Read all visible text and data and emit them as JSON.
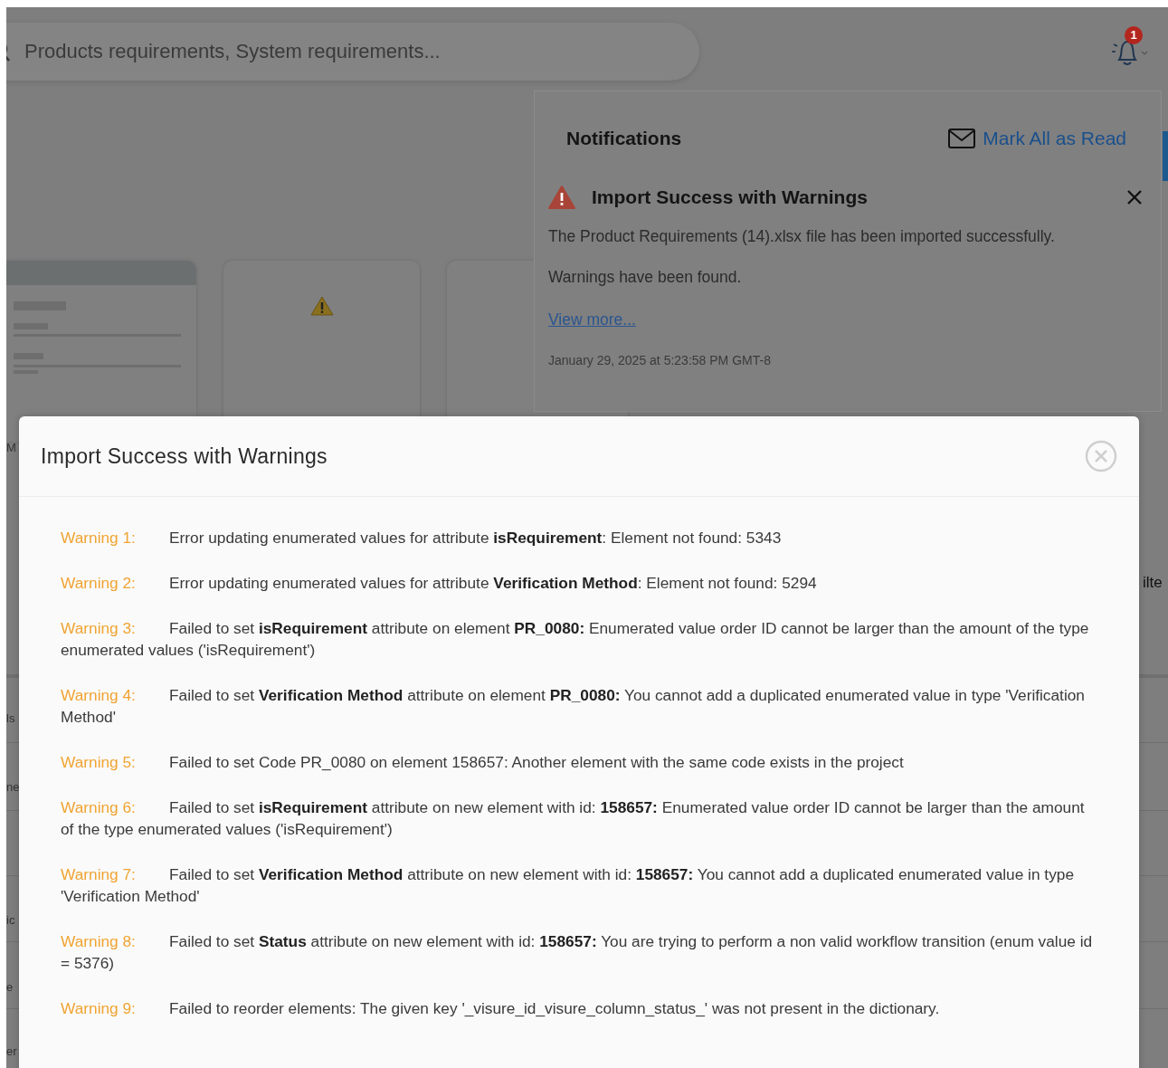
{
  "search": {
    "placeholder": "Products requirements, System requirements..."
  },
  "notification_badge": "1",
  "background_fragments": {
    "left": [
      "M",
      "ls",
      "ne",
      "ic",
      "e",
      "er"
    ],
    "right": [
      "ilte"
    ]
  },
  "notifications": {
    "title": "Notifications",
    "mark_all": "Mark All as Read",
    "items": [
      {
        "kind": "warning",
        "title": "Import Success with Warnings",
        "message": "The Product Requirements (14).xlsx file has been imported successfully.",
        "detail": "Warnings have been found.",
        "link": "View more...",
        "time": "January 29, 2025 at 5:23:58 PM GMT-8"
      }
    ]
  },
  "dialog": {
    "title": "Import Success with Warnings",
    "warnings": [
      {
        "label": "Warning 1:",
        "message": "Error updating enumerated values for attribute **isRequirement**: Element not found: 5343"
      },
      {
        "label": "Warning 2:",
        "message": "Error updating enumerated values for attribute **Verification Method**: Element not found: 5294"
      },
      {
        "label": "Warning 3:",
        "message": "Failed to set **isRequirement** attribute on element **PR_0080:** Enumerated value order ID cannot be larger than the amount of the type enumerated values ('isRequirement')"
      },
      {
        "label": "Warning 4:",
        "message": "Failed to set **Verification Method** attribute on element **PR_0080:** You cannot add a duplicated enumerated value in type 'Verification Method'"
      },
      {
        "label": "Warning 5:",
        "message": "Failed to set Code PR_0080 on element 158657: Another element with the same code exists in the project"
      },
      {
        "label": "Warning 6:",
        "message": "Failed to set **isRequirement** attribute on new element with id: **158657:** Enumerated value order ID cannot be larger than the amount of the type enumerated values ('isRequirement')"
      },
      {
        "label": "Warning 7:",
        "message": "Failed to set **Verification Method** attribute on new element with id: **158657:** You cannot add a duplicated enumerated value in type 'Verification Method'"
      },
      {
        "label": "Warning 8:",
        "message": "Failed to set **Status** attribute on new element with id: **158657:** You are trying to perform a non valid workflow transition (enum value id = 5376)"
      },
      {
        "label": "Warning 9:",
        "message": "Failed to reorder elements: The given key '_visure_id_visure_column_status_' was not present in the dictionary."
      }
    ]
  }
}
